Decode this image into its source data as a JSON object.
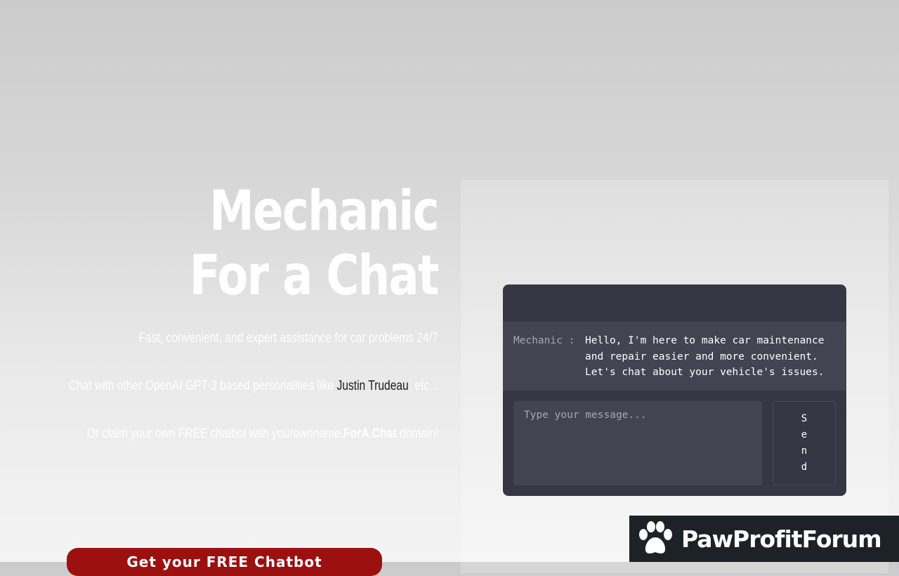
{
  "hero": {
    "title": "Mechanic For a Chat",
    "tagline": "Fast, convenient, and expert assistance for car problems 24/7",
    "others_prefix": "Chat with other OpenAI GPT-3 based personalities like ",
    "others_link": "Justin Trudeau",
    "others_suffix": ", etc...",
    "claim_prefix": "Or claim your own FREE chatbot with ",
    "claim_italic": "yourownname",
    "claim_domain": ".ForA.Chat",
    "claim_suffix": " domain!"
  },
  "chat": {
    "speaker": "Mechanic : ",
    "message": "Hello, I'm here to make car maintenance\nand repair easier and more convenient.\nLet's chat about your vehicle's issues.",
    "input_placeholder": "Type your message...",
    "send_label": "Send"
  },
  "cta": {
    "label": "Get your FREE Chatbot"
  },
  "badge": {
    "text": "PawProfitForum",
    "icon": "paw-icon"
  },
  "colors": {
    "chat_bg": "#363644",
    "message_bg": "#434351",
    "cta_bg": "#9c1010",
    "badge_bg": "#1d2229"
  }
}
